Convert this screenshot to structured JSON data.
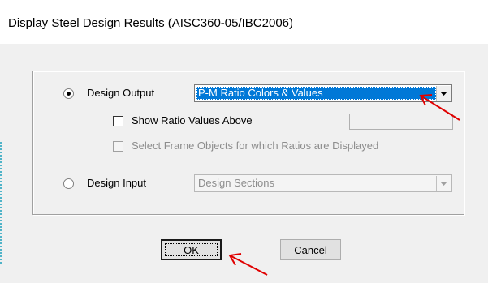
{
  "dialog": {
    "title": "Display Steel Design Results  (AISC360-05/IBC2006)"
  },
  "design_output": {
    "label": "Design Output",
    "selected": true,
    "combo_value": "P-M Ratio Colors & Values"
  },
  "show_ratio": {
    "label": "Show Ratio Values Above",
    "checked": false,
    "value": ""
  },
  "select_frames": {
    "label": "Select Frame Objects for which Ratios are Displayed",
    "checked": false,
    "enabled": false
  },
  "design_input": {
    "label": "Design Input",
    "selected": false,
    "combo_value": "Design Sections"
  },
  "buttons": {
    "ok": "OK",
    "cancel": "Cancel"
  },
  "annotation_color": "#e00000"
}
